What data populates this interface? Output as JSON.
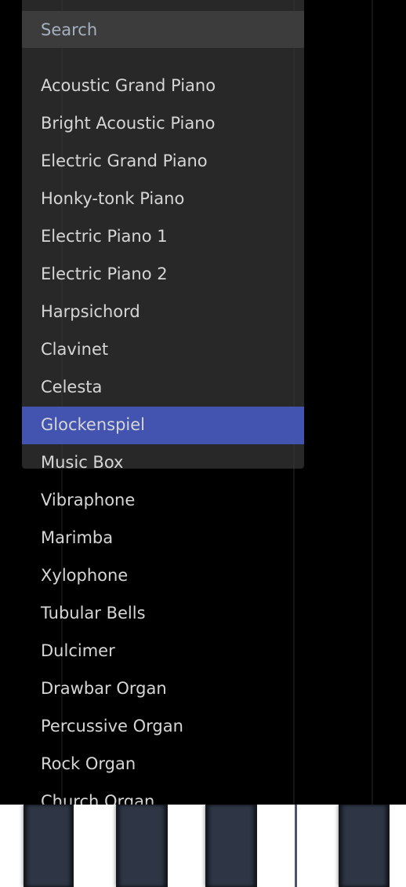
{
  "search": {
    "placeholder": "Search",
    "value": ""
  },
  "instrument_list": {
    "selected_index": 9,
    "items": [
      {
        "label": "Acoustic Grand Piano"
      },
      {
        "label": "Bright Acoustic Piano"
      },
      {
        "label": "Electric Grand Piano"
      },
      {
        "label": "Honky-tonk Piano"
      },
      {
        "label": "Electric Piano 1"
      },
      {
        "label": "Electric Piano 2"
      },
      {
        "label": "Harpsichord"
      },
      {
        "label": "Clavinet"
      },
      {
        "label": "Celesta"
      },
      {
        "label": "Glockenspiel"
      },
      {
        "label": "Music Box"
      },
      {
        "label": "Vibraphone"
      },
      {
        "label": "Marimba"
      },
      {
        "label": "Xylophone"
      },
      {
        "label": "Tubular Bells"
      },
      {
        "label": "Dulcimer"
      },
      {
        "label": "Drawbar Organ"
      },
      {
        "label": "Percussive Organ"
      },
      {
        "label": "Rock Organ"
      },
      {
        "label": "Church Organ"
      }
    ]
  },
  "keyboard": {
    "black_key_count": 4,
    "white_key_count": 5
  },
  "colors": {
    "background": "#000000",
    "panel": "#282828",
    "search_bar": "#3c3c3c",
    "selected": "#4253b0",
    "item_text": "#d6d6d6",
    "placeholder_text": "#a6b0bf",
    "black_key": "#2e3645"
  }
}
